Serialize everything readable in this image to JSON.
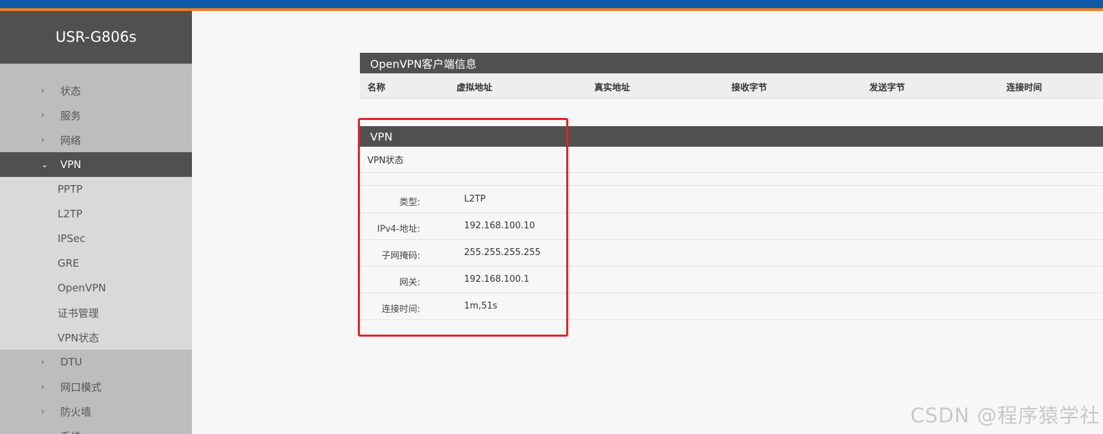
{
  "brand": "USR-G806s",
  "menu": {
    "top": [
      {
        "label": "状态"
      },
      {
        "label": "服务"
      },
      {
        "label": "网络"
      }
    ],
    "active": {
      "label": "VPN"
    },
    "sub": [
      {
        "label": "PPTP"
      },
      {
        "label": "L2TP"
      },
      {
        "label": "IPSec"
      },
      {
        "label": "GRE"
      },
      {
        "label": "OpenVPN"
      },
      {
        "label": "证书管理"
      },
      {
        "label": "VPN状态"
      }
    ],
    "bottom": [
      {
        "label": "DTU"
      },
      {
        "label": "网口模式"
      },
      {
        "label": "防火墙"
      },
      {
        "label": "系统"
      }
    ]
  },
  "openvpn": {
    "title": "OpenVPN客户端信息",
    "columns": [
      "名称",
      "虚拟地址",
      "真实地址",
      "接收字节",
      "发送字节",
      "连接时间"
    ]
  },
  "vpn": {
    "title": "VPN",
    "status_label": "VPN状态",
    "rows": [
      {
        "key": "类型:",
        "value": "L2TP"
      },
      {
        "key": "IPv4-地址:",
        "value": "192.168.100.10"
      },
      {
        "key": "子网掩码:",
        "value": "255.255.255.255"
      },
      {
        "key": "网关:",
        "value": "192.168.100.1"
      },
      {
        "key": "连接时间:",
        "value": "1m,51s"
      }
    ]
  },
  "watermark": "CSDN @程序猿学社",
  "colors": {
    "topbar": "#0d5aa7",
    "accent": "#f07b22",
    "sidebar": "#bdbdbd",
    "header_dark": "#505050",
    "highlight": "#e02424"
  }
}
